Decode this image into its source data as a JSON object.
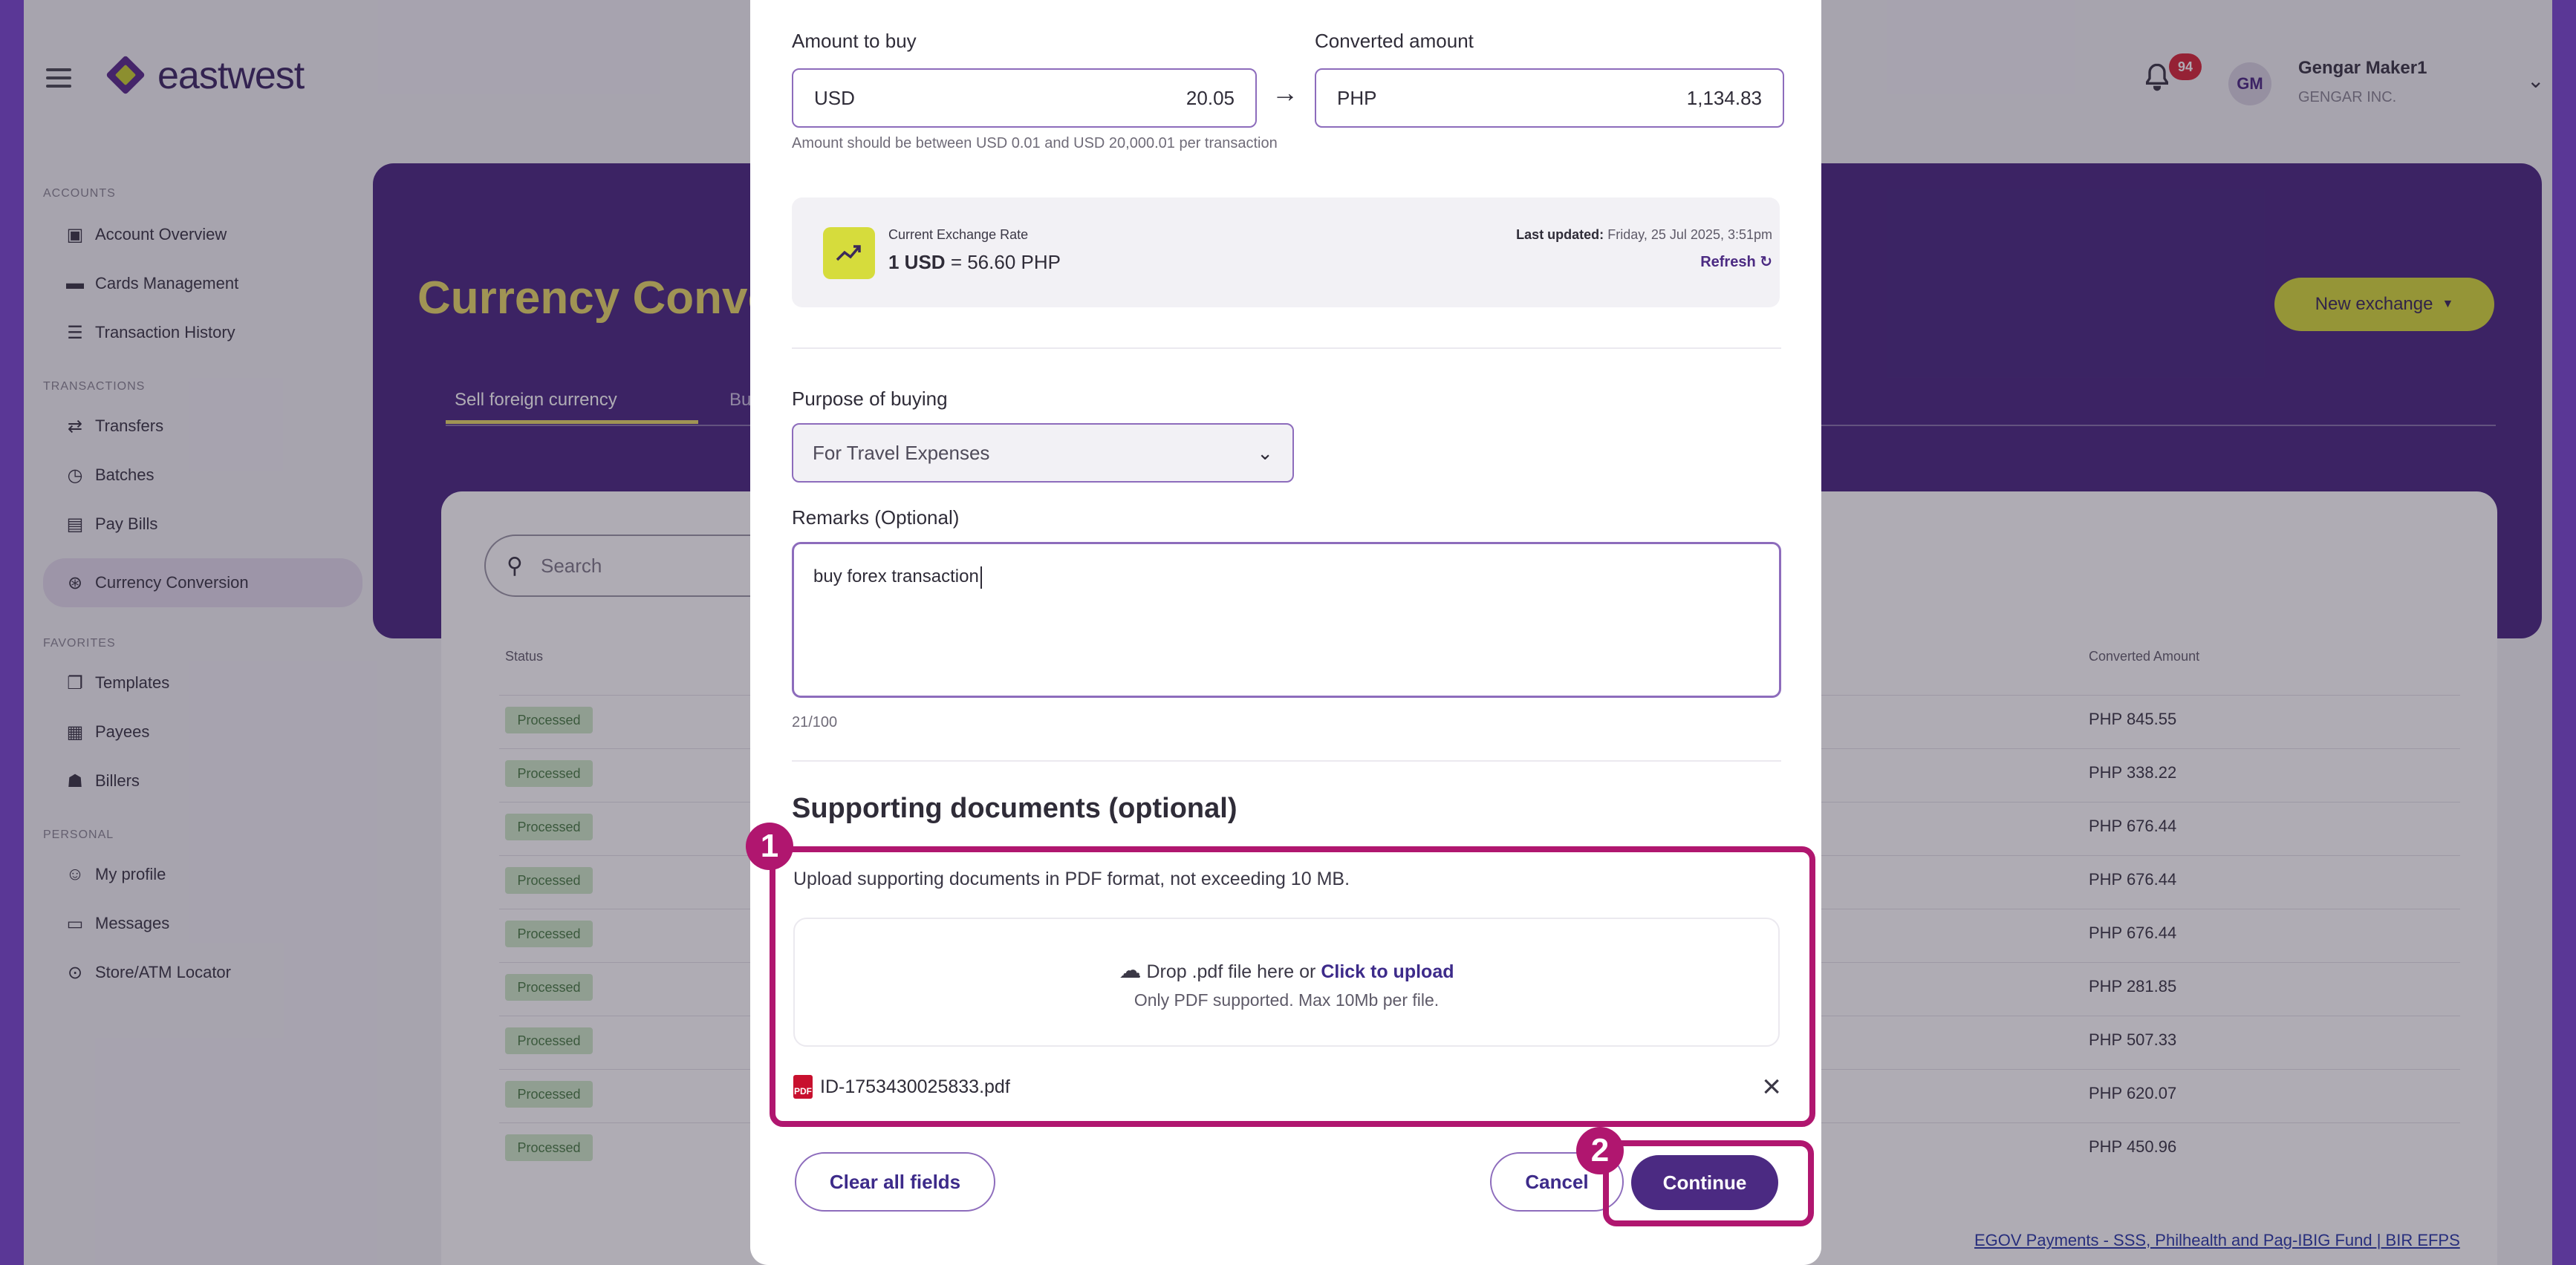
{
  "brand": {
    "name": "eastwest"
  },
  "sidebar": {
    "sections": [
      {
        "title": "ACCOUNTS",
        "items": [
          {
            "label": "Account Overview",
            "icon": "account-overview-icon"
          },
          {
            "label": "Cards Management",
            "icon": "card-icon"
          },
          {
            "label": "Transaction History",
            "icon": "list-icon"
          }
        ]
      },
      {
        "title": "TRANSACTIONS",
        "items": [
          {
            "label": "Transfers",
            "icon": "transfer-icon"
          },
          {
            "label": "Batches",
            "icon": "batches-icon"
          },
          {
            "label": "Pay Bills",
            "icon": "bills-icon"
          },
          {
            "label": "Currency Conversion",
            "icon": "currency-icon",
            "active": true
          }
        ]
      },
      {
        "title": "FAVORITES",
        "items": [
          {
            "label": "Templates",
            "icon": "templates-icon"
          },
          {
            "label": "Payees",
            "icon": "payees-icon"
          },
          {
            "label": "Billers",
            "icon": "billers-icon"
          }
        ]
      },
      {
        "title": "PERSONAL",
        "items": [
          {
            "label": "My profile",
            "icon": "profile-icon"
          },
          {
            "label": "Messages",
            "icon": "messages-icon"
          },
          {
            "label": "Store/ATM Locator",
            "icon": "location-icon"
          }
        ]
      }
    ]
  },
  "header": {
    "notifications_count": "94",
    "avatar_initials": "GM",
    "user_name": "Gengar Maker1",
    "user_org": "GENGAR INC."
  },
  "page": {
    "title": "Currency Convers",
    "tabs": [
      "Sell foreign currency",
      "Buy"
    ],
    "new_exchange_label": "New exchange",
    "search_placeholder": "Search",
    "columns": {
      "status": "Status",
      "converted_amount": "Converted Amount"
    },
    "rows": [
      {
        "status": "Processed",
        "converted_amount": "PHP 845.55"
      },
      {
        "status": "Processed",
        "converted_amount": "PHP 338.22"
      },
      {
        "status": "Processed",
        "converted_amount": "PHP 676.44"
      },
      {
        "status": "Processed",
        "converted_amount": "PHP 676.44"
      },
      {
        "status": "Processed",
        "converted_amount": "PHP 676.44"
      },
      {
        "status": "Processed",
        "converted_amount": "PHP 281.85"
      },
      {
        "status": "Processed",
        "converted_amount": "PHP 507.33"
      },
      {
        "status": "Processed",
        "converted_amount": "PHP 620.07"
      },
      {
        "status": "Processed",
        "converted_amount": "PHP 450.96"
      }
    ],
    "footer_link": "EGOV Payments - SSS, Philhealth and Pag-IBIG Fund | BIR EFPS"
  },
  "modal": {
    "amount_to_buy_label": "Amount to buy",
    "amount_currency": "USD",
    "amount_value": "20.05",
    "converted_label": "Converted amount",
    "converted_currency": "PHP",
    "converted_value": "1,134.83",
    "amount_hint": "Amount should be between USD 0.01 and USD 20,000.01 per transaction",
    "rate": {
      "label": "Current Exchange Rate",
      "value_prefix": "1 USD",
      "value_suffix": "= 56.60 PHP",
      "last_updated_label": "Last updated:",
      "last_updated_value": "Friday, 25 Jul 2025, 3:51pm",
      "refresh_label": "Refresh"
    },
    "purpose_label": "Purpose of buying",
    "purpose_value": "For Travel Expenses",
    "remarks_label": "Remarks (Optional)",
    "remarks_value": "buy forex transaction",
    "remarks_counter": "21/100",
    "docs_title": "Supporting documents (optional)",
    "docs_hint": "Upload supporting documents in PDF format, not exceeding 10 MB.",
    "drop_text": "Drop .pdf file here or",
    "drop_link": "Click to upload",
    "drop_sub": "Only PDF supported. Max 10Mb per file.",
    "file_name": "ID-1753430025833.pdf",
    "clear_label": "Clear all fields",
    "cancel_label": "Cancel",
    "continue_label": "Continue"
  },
  "annotations": {
    "marker_1": "1",
    "marker_2": "2"
  },
  "colors": {
    "brand_purple": "#4b2a82",
    "accent_lime": "#d6dc3c",
    "highlight": "#b0166f"
  }
}
